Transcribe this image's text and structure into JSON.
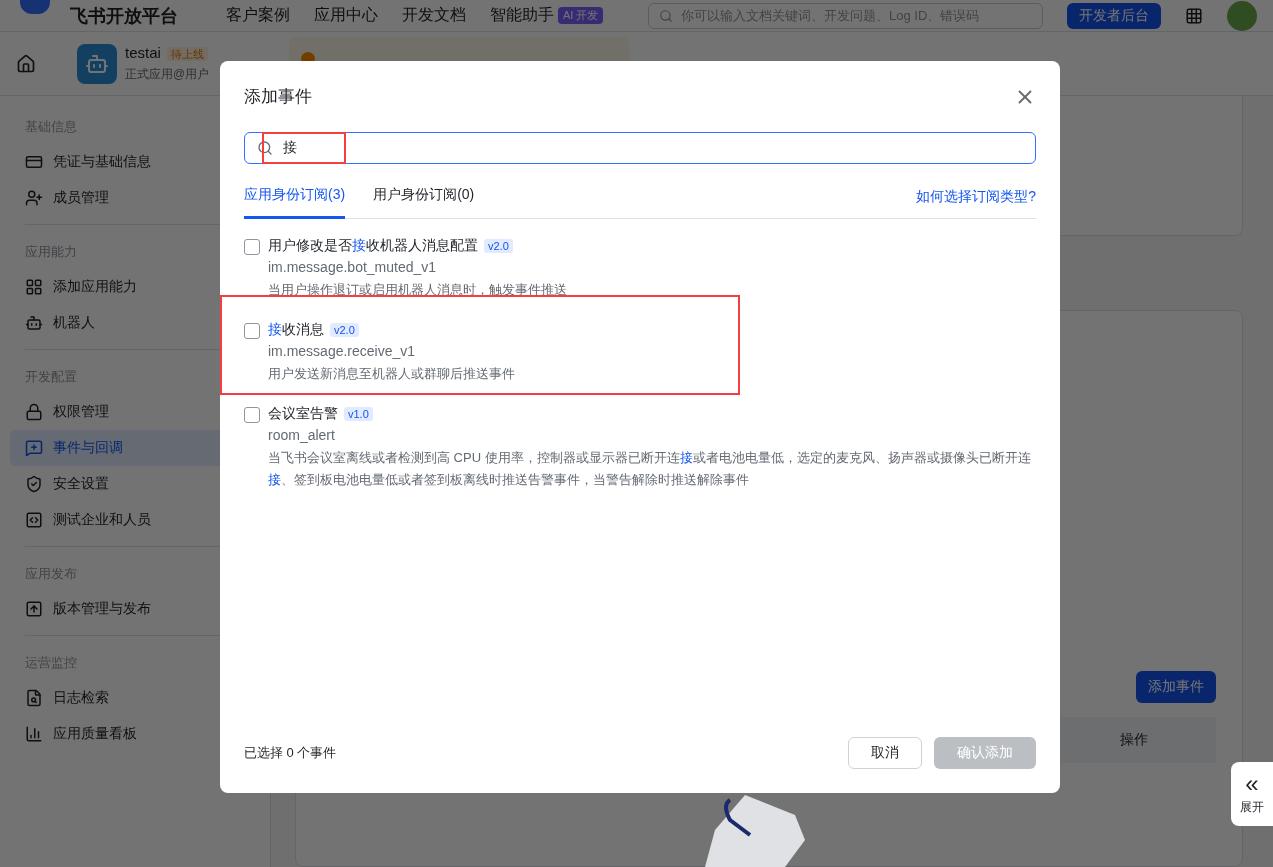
{
  "top_bar": {
    "brand": "飞书开放平台",
    "nav": [
      "客户案例",
      "应用中心",
      "开发文档",
      "智能助手"
    ],
    "ai_badge": "AI 开发",
    "search": {
      "placeholder": "你可以输入文档关键词、开发问题、Log ID、错误码"
    },
    "console_button": "开发者后台"
  },
  "app_header": {
    "name": "testai",
    "status": "待上线",
    "subtitle": "正式应用@用户"
  },
  "sidebar": [
    {
      "title": "基础信息",
      "items": [
        {
          "label": "凭证与基础信息",
          "selected": false
        },
        {
          "label": "成员管理",
          "selected": false
        }
      ]
    },
    {
      "title": "应用能力",
      "items": [
        {
          "label": "添加应用能力",
          "selected": false
        },
        {
          "label": "机器人",
          "selected": false
        }
      ]
    },
    {
      "title": "开发配置",
      "items": [
        {
          "label": "权限管理",
          "selected": false
        },
        {
          "label": "事件与回调",
          "selected": true
        },
        {
          "label": "安全设置",
          "selected": false
        },
        {
          "label": "测试企业和人员",
          "selected": false
        }
      ]
    },
    {
      "title": "应用发布",
      "items": [
        {
          "label": "版本管理与发布",
          "selected": false
        }
      ]
    },
    {
      "title": "运营监控",
      "items": [
        {
          "label": "日志检索",
          "selected": false
        },
        {
          "label": "应用质量看板",
          "selected": false
        }
      ]
    }
  ],
  "main": {
    "add_button": "添加事件",
    "table_columns": [
      "操作"
    ]
  },
  "expand_tab": {
    "icon": "«",
    "label": "展开"
  },
  "dialog": {
    "title": "添加事件",
    "search": {
      "value": "接",
      "annotated": true
    },
    "tabs": [
      {
        "label": "应用身份订阅(3)",
        "selected": true
      },
      {
        "label": "用户身份订阅(0)",
        "selected": false
      }
    ],
    "help_link": "如何选择订阅类型?",
    "events": [
      {
        "checked": false,
        "annotated": false,
        "title": [
          {
            "text": "用户修改是否",
            "match": false
          },
          {
            "text": "接",
            "match": true
          },
          {
            "text": "收机器人消息配置",
            "match": false
          }
        ],
        "version": "v2.0",
        "key": "im.message.bot_muted_v1",
        "description": [
          {
            "text": "当用户操作退订或启用机器人消息时，触发事件推送",
            "match": false
          }
        ]
      },
      {
        "checked": false,
        "annotated": true,
        "title": [
          {
            "text": "接",
            "match": true
          },
          {
            "text": "收消息",
            "match": false
          }
        ],
        "version": "v2.0",
        "key": "im.message.receive_v1",
        "description": [
          {
            "text": "用户发送新消息至机器人或群聊后推送事件",
            "match": false
          }
        ]
      },
      {
        "checked": false,
        "annotated": false,
        "title": [
          {
            "text": "会议室告警",
            "match": false
          }
        ],
        "version": "v1.0",
        "key": "room_alert",
        "description": [
          {
            "text": "当飞书会议室离线或者检测到高 CPU 使用率，控制器或显示器已断开连",
            "match": false
          },
          {
            "text": "接",
            "match": true
          },
          {
            "text": "或者电池电量低，选定的麦克风、扬声器或摄像头已断开连",
            "match": false
          },
          {
            "text": "接",
            "match": true
          },
          {
            "text": "、签到板电池电量低或者签到板离线时推送告警事件，当警告解除时推送解除事件",
            "match": false
          }
        ]
      }
    ],
    "selected_count": "已选择 0 个事件",
    "buttons": [
      {
        "label": "取消",
        "kind": "secondary",
        "disabled": false
      },
      {
        "label": "确认添加",
        "kind": "primary",
        "disabled": true
      }
    ]
  }
}
